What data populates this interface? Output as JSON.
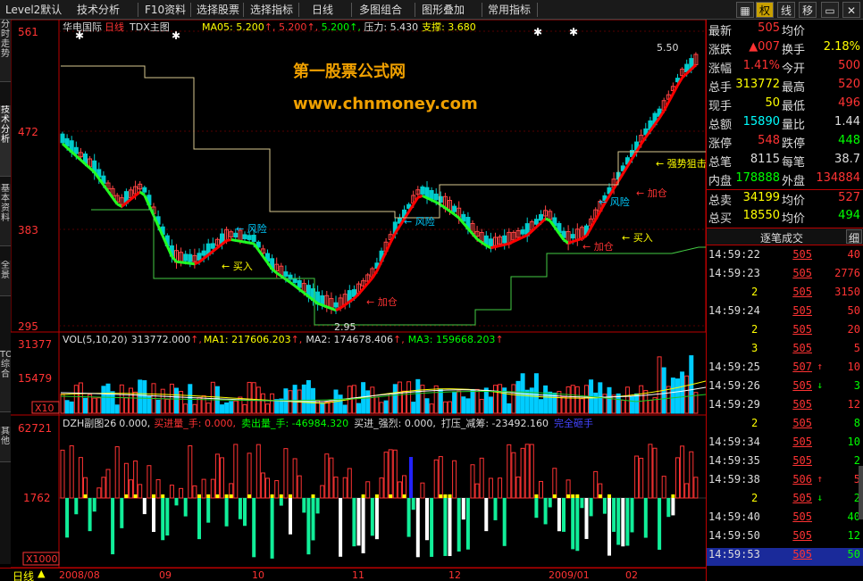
{
  "menu": {
    "items": [
      "Level2默认",
      "技术分析",
      "F10资料",
      "选择股票",
      "选择指标",
      "日线",
      "多图组合",
      "图形叠加",
      "常用指标"
    ],
    "right_buttons": [
      "权",
      "线",
      "移"
    ],
    "active_right": "权"
  },
  "sidebar": {
    "tabs": [
      "分时走势",
      "技术分析",
      "基本资料",
      "全景",
      "TOP综合",
      "其他"
    ]
  },
  "main_chart": {
    "stock_name": "华电国际",
    "period": "日线",
    "formula": "TDX主图",
    "ma_text": "MA05: 5.200",
    "val1": "5.200",
    "val2": "5.200",
    "pressure": "压力: 5.430",
    "support": "支撑: 3.680",
    "watermark_line1": "第一股票公式网",
    "watermark_line2": "www.chnmoney.com",
    "y_ticks": [
      "561",
      "472",
      "383",
      "295"
    ],
    "high_label": "5.50",
    "low_label": "2.95",
    "signals": {
      "buy1": "买入",
      "add1": "加仓",
      "risk1": "风险",
      "risk2": "风险",
      "risk3": "风险",
      "add2": "加仓",
      "buy2": "买入",
      "add3": "加仓",
      "strong": "强势狙击"
    }
  },
  "vol_chart": {
    "title": "VOL(5,10,20)",
    "vol_value": "313772.000",
    "ma1": "MA1: 217606.203",
    "ma2": "MA2: 174678.406",
    "ma3": "MA3: 159668.203",
    "y_ticks": [
      "31377",
      "15479"
    ],
    "unit": "X10"
  },
  "dzh_chart": {
    "title": "DZH副图26",
    "v0": "0.000,",
    "buy_vol": "买进量_手: 0.000,",
    "sell_vol": "卖出量_手: -46984.320",
    "buy_strong": "买进_强烈: 0.000,",
    "press": "打压_减筹: -23492.160",
    "full_short": "完全砸手",
    "y_ticks": [
      "62721",
      "1762"
    ],
    "unit": "X1000"
  },
  "x_axis": {
    "period_label": "日线",
    "labels": [
      "2008/08",
      "09",
      "10",
      "11",
      "12",
      "2009/01",
      "02"
    ]
  },
  "quote": {
    "rows": [
      {
        "l1": "最新",
        "v1": "505",
        "c1": "#f33",
        "l2": "均价",
        "v2": "",
        "c2": "#f33"
      },
      {
        "l1": "涨跌",
        "v1": "▲007",
        "c1": "#f33",
        "l2": "换手",
        "v2": "2.18%",
        "c2": "#ff0"
      },
      {
        "l1": "涨幅",
        "v1": "1.41%",
        "c1": "#f33",
        "l2": "今开",
        "v2": "500",
        "c2": "#f33"
      },
      {
        "l1": "总手",
        "v1": "313772",
        "c1": "#ff0",
        "l2": "最高",
        "v2": "520",
        "c2": "#f33"
      },
      {
        "l1": "现手",
        "v1": "50",
        "c1": "#ff0",
        "l2": "最低",
        "v2": "496",
        "c2": "#f33"
      },
      {
        "l1": "总额",
        "v1": "15890",
        "c1": "#0ff",
        "l2": "量比",
        "v2": "1.44",
        "c2": "#ddd"
      },
      {
        "l1": "涨停",
        "v1": "548",
        "c1": "#f33",
        "l2": "跌停",
        "v2": "448",
        "c2": "#0f0"
      },
      {
        "l1": "总笔",
        "v1": "8115",
        "c1": "#ddd",
        "l2": "每笔",
        "v2": "38.7",
        "c2": "#ddd"
      },
      {
        "l1": "内盘",
        "v1": "178888",
        "c1": "#0f0",
        "l2": "外盘",
        "v2": "134884",
        "c2": "#f33"
      }
    ],
    "sell_row": {
      "label": "总卖",
      "vol": "34199",
      "avg_label": "均价",
      "avg": "527"
    },
    "buy_row": {
      "label": "总买",
      "vol": "18550",
      "avg_label": "均价",
      "avg": "494"
    },
    "ticks_title": "逐笔成交",
    "ticks_btn": "细"
  },
  "ticks": [
    {
      "time": "14:59:22",
      "price": "505",
      "vol": "40",
      "vc": "#f33",
      "arrow": ""
    },
    {
      "time": "14:59:23",
      "price": "505",
      "vol": "2776",
      "vc": "#f33",
      "arrow": ""
    },
    {
      "time": "2",
      "price": "505",
      "vol": "3150",
      "vc": "#f33",
      "arrow": ""
    },
    {
      "time": "14:59:24",
      "price": "505",
      "vol": "50",
      "vc": "#f33",
      "arrow": ""
    },
    {
      "time": "2",
      "price": "505",
      "vol": "20",
      "vc": "#f33",
      "arrow": ""
    },
    {
      "time": "3",
      "price": "505",
      "vol": "5",
      "vc": "#f33",
      "arrow": ""
    },
    {
      "time": "14:59:25",
      "price": "507",
      "vol": "10",
      "vc": "#f33",
      "arrow": "up"
    },
    {
      "time": "14:59:26",
      "price": "505",
      "vol": "3",
      "vc": "#0f0",
      "arrow": "down"
    },
    {
      "time": "14:59:29",
      "price": "505",
      "vol": "12",
      "vc": "#f33",
      "arrow": ""
    },
    {
      "time": "2",
      "price": "505",
      "vol": "8",
      "vc": "#0f0",
      "arrow": ""
    },
    {
      "time": "14:59:34",
      "price": "505",
      "vol": "10",
      "vc": "#0f0",
      "arrow": ""
    },
    {
      "time": "14:59:35",
      "price": "505",
      "vol": "2",
      "vc": "#0f0",
      "arrow": ""
    },
    {
      "time": "14:59:38",
      "price": "506",
      "vol": "5",
      "vc": "#f33",
      "arrow": "up"
    },
    {
      "time": "2",
      "price": "505",
      "vol": "2",
      "vc": "#0f0",
      "arrow": "down"
    },
    {
      "time": "14:59:40",
      "price": "505",
      "vol": "40",
      "vc": "#0f0",
      "arrow": ""
    },
    {
      "time": "14:59:50",
      "price": "505",
      "vol": "12",
      "vc": "#0f0",
      "arrow": ""
    },
    {
      "time": "14:59:53",
      "price": "505",
      "vol": "50",
      "vc": "#0f0",
      "arrow": ""
    }
  ]
}
